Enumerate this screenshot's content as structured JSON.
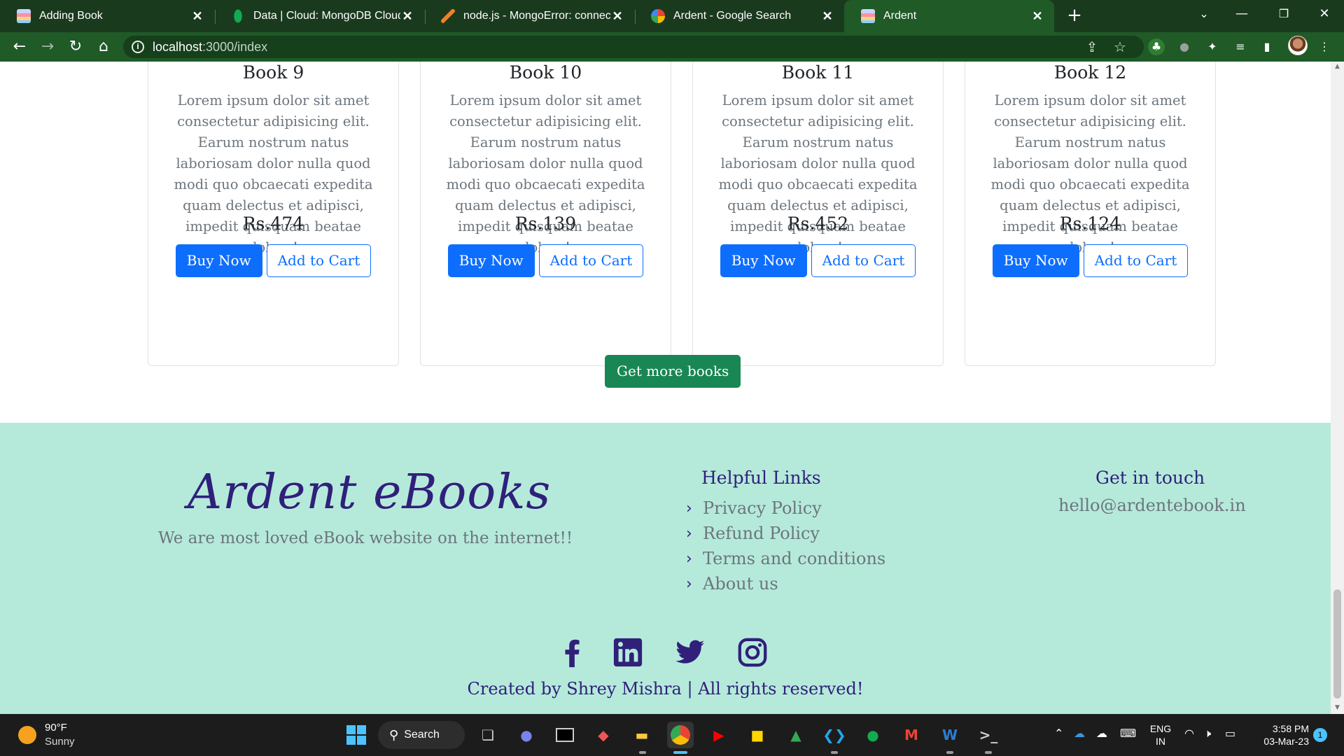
{
  "browser": {
    "tabs": [
      {
        "title": "Adding Book",
        "icon": "book-favicon",
        "active": false
      },
      {
        "title": "Data | Cloud: MongoDB Cloud",
        "icon": "mongodb-leaf-favicon",
        "active": false
      },
      {
        "title": "node.js - MongoError: connect EC",
        "icon": "stackoverflow-favicon",
        "active": false
      },
      {
        "title": "Ardent - Google Search",
        "icon": "google-favicon",
        "active": false
      },
      {
        "title": "Ardent",
        "icon": "book-favicon",
        "active": true
      }
    ],
    "url_host": "localhost",
    "url_path": ":3000/index",
    "accent": "#1f5a27"
  },
  "books": [
    {
      "title": "Book 9",
      "description": "Lorem ipsum dolor sit amet consectetur adipisicing elit. Earum nostrum natus laboriosam dolor nulla quod modi quo obcaecati expedita quam delectus et adipisci, impedit quisquam beatae dolore!",
      "price": "Rs.474",
      "buy_label": "Buy Now",
      "cart_label": "Add to Cart"
    },
    {
      "title": "Book 10",
      "description": "Lorem ipsum dolor sit amet consectetur adipisicing elit. Earum nostrum natus laboriosam dolor nulla quod modi quo obcaecati expedita quam delectus et adipisci, impedit quisquam beatae dolore!",
      "price": "Rs.139",
      "buy_label": "Buy Now",
      "cart_label": "Add to Cart"
    },
    {
      "title": "Book 11",
      "description": "Lorem ipsum dolor sit amet consectetur adipisicing elit. Earum nostrum natus laboriosam dolor nulla quod modi quo obcaecati expedita quam delectus et adipisci, impedit quisquam beatae dolore!",
      "price": "Rs.452",
      "buy_label": "Buy Now",
      "cart_label": "Add to Cart"
    },
    {
      "title": "Book 12",
      "description": "Lorem ipsum dolor sit amet consectetur adipisicing elit. Earum nostrum natus laboriosam dolor nulla quod modi quo obcaecati expedita quam delectus et adipisci, impedit quisquam beatae dolore!",
      "price": "Rs.124",
      "buy_label": "Buy Now",
      "cart_label": "Add to Cart"
    }
  ],
  "more_books_label": "Get more books",
  "footer": {
    "brand": "Ardent eBooks",
    "tagline": "We are most loved eBook website on the internet!!",
    "links_heading": "Helpful Links",
    "links": [
      "Privacy Policy",
      "Refund Policy",
      "Terms and conditions",
      "About us"
    ],
    "contact_heading": "Get in touch",
    "email": "hello@ardentebook.in",
    "social": [
      "facebook-icon",
      "linkedin-icon",
      "twitter-icon",
      "instagram-icon"
    ],
    "copyright": "Created by Shrey Mishra | All rights reserved!",
    "background": "#b5eadb",
    "text_color": "#30207a"
  },
  "taskbar": {
    "weather_temp": "90°F",
    "weather_desc": "Sunny",
    "search_label": "Search",
    "lang_1": "ENG",
    "lang_2": "IN",
    "time": "3:58 PM",
    "date": "03-Mar-23",
    "notification_count": "1"
  },
  "colors": {
    "primary": "#0d6efd",
    "success": "#198754"
  }
}
